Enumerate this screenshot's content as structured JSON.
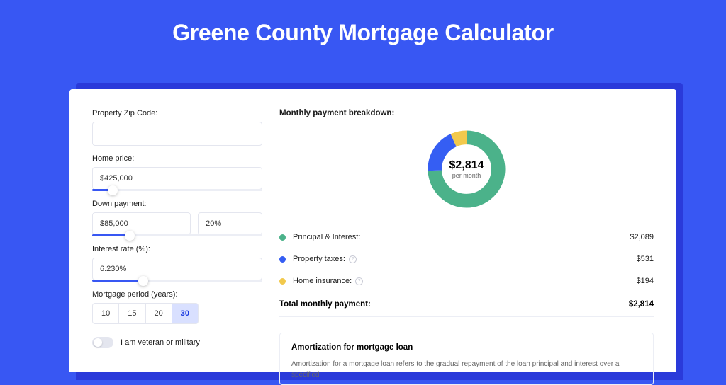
{
  "page": {
    "title": "Greene County Mortgage Calculator"
  },
  "form": {
    "zip": {
      "label": "Property Zip Code:",
      "value": ""
    },
    "home_price": {
      "label": "Home price:",
      "value": "$425,000",
      "slider_pct": 12
    },
    "down": {
      "label": "Down payment:",
      "value": "$85,000",
      "pct": "20%",
      "slider_pct": 22
    },
    "rate": {
      "label": "Interest rate (%):",
      "value": "6.230%",
      "slider_pct": 30
    },
    "period": {
      "label": "Mortgage period (years):",
      "options": [
        "10",
        "15",
        "20",
        "30"
      ],
      "active": "30"
    },
    "veteran": {
      "label": "I am veteran or military",
      "on": false
    }
  },
  "breakdown": {
    "title": "Monthly payment breakdown:",
    "donut": {
      "center_amount": "$2,814",
      "center_caption": "per month"
    },
    "items": [
      {
        "name": "Principal & Interest:",
        "value": "$2,089",
        "color": "#4bb28a",
        "info": false
      },
      {
        "name": "Property taxes:",
        "value": "$531",
        "color": "#355ef3",
        "info": true
      },
      {
        "name": "Home insurance:",
        "value": "$194",
        "color": "#f2c94c",
        "info": true
      }
    ],
    "total": {
      "label": "Total monthly payment:",
      "value": "$2,814"
    }
  },
  "chart_data": {
    "type": "pie",
    "title": "Monthly payment breakdown",
    "series": [
      {
        "name": "Principal & Interest",
        "value": 2089,
        "color": "#4bb28a"
      },
      {
        "name": "Property taxes",
        "value": 531,
        "color": "#355ef3"
      },
      {
        "name": "Home insurance",
        "value": 194,
        "color": "#f2c94c"
      }
    ],
    "total": 2814,
    "center_label": "$2,814 per month"
  },
  "amort": {
    "title": "Amortization for mortgage loan",
    "body": "Amortization for a mortgage loan refers to the gradual repayment of the loan principal and interest over a specified"
  }
}
